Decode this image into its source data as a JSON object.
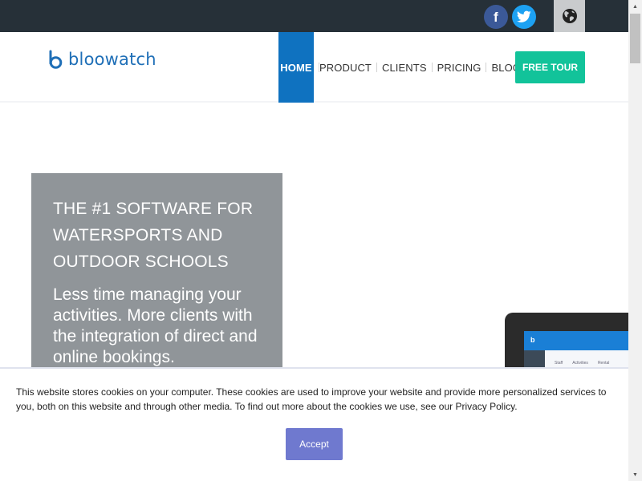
{
  "topbar": {
    "social": [
      {
        "name": "facebook-icon",
        "color": "#3b5998",
        "glyph": "f"
      },
      {
        "name": "twitter-icon",
        "color": "#1da1f2"
      }
    ],
    "language_icon": "globe-icon"
  },
  "header": {
    "logo_text": "bloowatch",
    "nav": [
      {
        "label": "HOME",
        "active": true
      },
      {
        "label": "PRODUCT",
        "active": false
      },
      {
        "label": "CLIENTS",
        "active": false
      },
      {
        "label": "PRICING",
        "active": false
      },
      {
        "label": "BLOG",
        "active": false
      }
    ],
    "cta_label": "FREE TOUR"
  },
  "hero": {
    "title": "THE #1 SOFTWARE FOR WATERSPORTS AND OUTDOOR SCHOOLS",
    "subtitle": "Less time managing your activities. More clients with the integration of direct and online bookings."
  },
  "tablet": {
    "logo_letter": "b",
    "menu": [
      "Staff",
      "Activities",
      "Rental"
    ]
  },
  "cookie": {
    "text": "This website stores cookies on your computer. These cookies are used to improve your website and provide more personalized services to you, both on this website and through other media. To find out more about the cookies we use, see our Privacy Policy.",
    "accept_label": "Accept"
  },
  "colors": {
    "brand": "#1f6fb7",
    "nav_active": "#0f72c0",
    "cta": "#12c39a",
    "hero_box": "#909599",
    "accept": "#6f79cf",
    "topbar": "#263038"
  }
}
